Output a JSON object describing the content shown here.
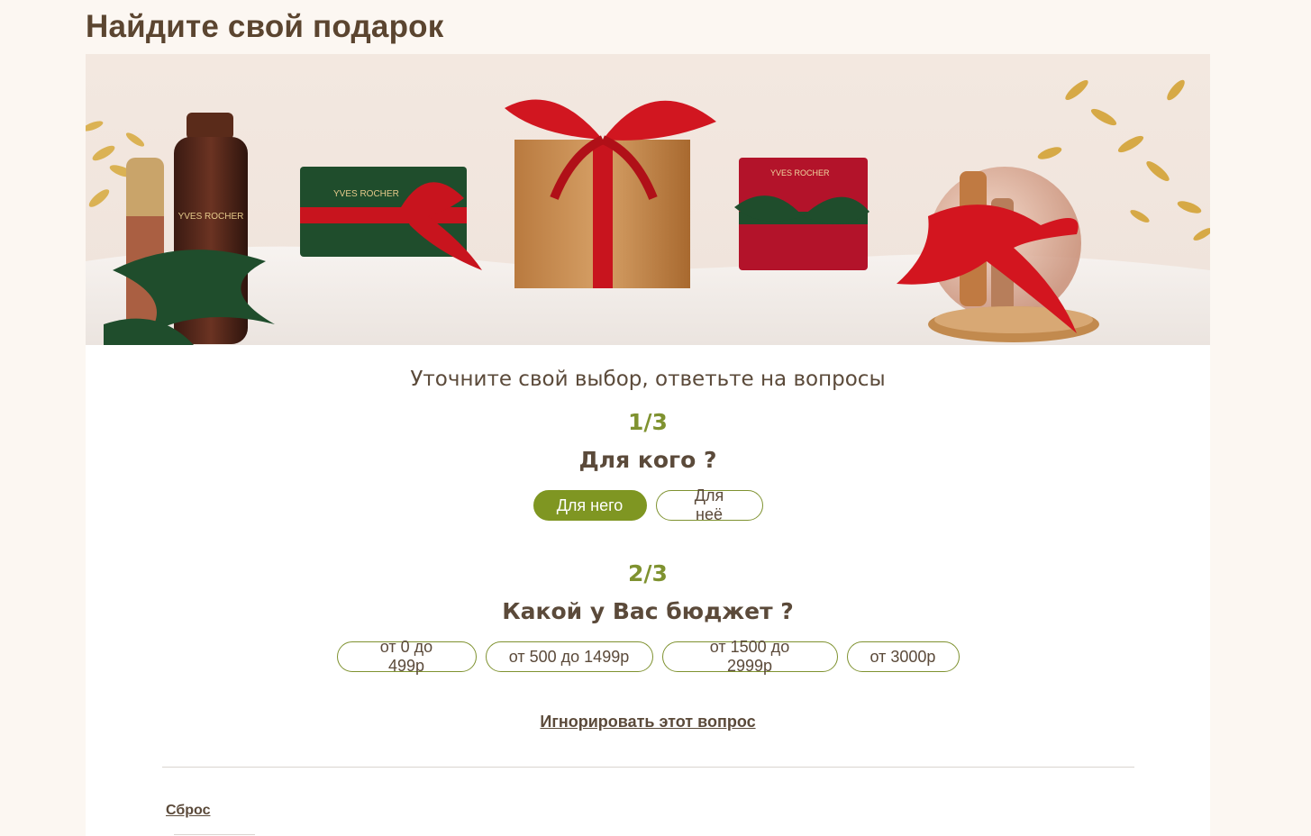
{
  "page": {
    "title": "Найдите свой подарок"
  },
  "banner": {
    "brand_text": "YVES ROCHER",
    "colors": {
      "sand": "#efe6df",
      "gift_red": "#c8141e",
      "gift_green": "#1f4d2c",
      "gold": "#d7a93c",
      "wood": "#c28a4e"
    }
  },
  "quiz": {
    "intro": "Уточните свой выбор, ответьте на вопросы",
    "questions": [
      {
        "step": "1/3",
        "title": "Для кого ?",
        "options": [
          {
            "label": "Для него",
            "selected": true
          },
          {
            "label": "Для неё",
            "selected": false
          }
        ]
      },
      {
        "step": "2/3",
        "title": "Какой у Вас бюджет ?",
        "options": [
          {
            "label": "от 0 до 499р",
            "selected": false
          },
          {
            "label": "от 500 до 1499р",
            "selected": false
          },
          {
            "label": "от 1500 до 2999р",
            "selected": false
          },
          {
            "label": "от 3000р",
            "selected": false
          }
        ]
      }
    ],
    "skip_label": "Игнорировать этот вопрос",
    "reset_label": "Сброс"
  },
  "colors": {
    "accent_green": "#7f9622",
    "text_brown": "#5b4a3a",
    "page_bg": "#fcf7f2"
  }
}
